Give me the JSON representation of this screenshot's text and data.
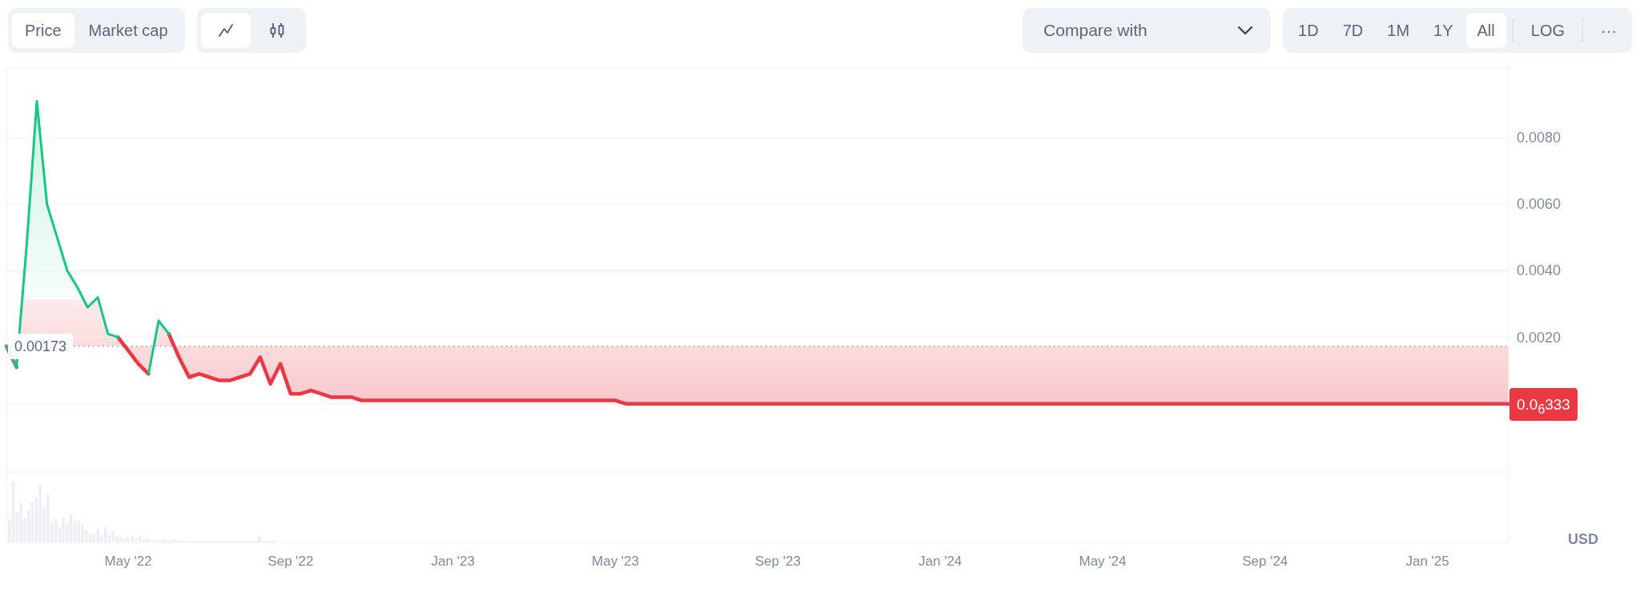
{
  "metric_tabs": [
    {
      "label": "Price",
      "selected": true
    },
    {
      "label": "Market cap",
      "selected": false
    }
  ],
  "chart_type_buttons": [
    {
      "kind": "line",
      "selected": true
    },
    {
      "kind": "candles",
      "selected": false
    }
  ],
  "compare_dropdown": {
    "label": "Compare with"
  },
  "range_buttons": [
    {
      "label": "1D",
      "selected": false
    },
    {
      "label": "7D",
      "selected": false
    },
    {
      "label": "1M",
      "selected": false
    },
    {
      "label": "1Y",
      "selected": false
    },
    {
      "label": "All",
      "selected": true
    }
  ],
  "log_button": {
    "label": "LOG",
    "selected": false
  },
  "more_button": {
    "label": "···"
  },
  "chart": {
    "baseline_label": "0.00173",
    "current_price_label": "0.0$_{6}$333",
    "chart_data": {
      "type": "line",
      "ylabel": "USD",
      "grid": true,
      "categories": [
        null,
        null,
        null,
        null,
        null,
        null,
        null,
        null,
        null,
        null,
        null,
        null,
        "May '22",
        null,
        null,
        null,
        null,
        null,
        null,
        null,
        null,
        null,
        null,
        null,
        null,
        null,
        null,
        null,
        "Sep '22",
        null,
        null,
        null,
        null,
        null,
        null,
        null,
        null,
        null,
        null,
        null,
        null,
        null,
        null,
        null,
        "Jan '23",
        null,
        null,
        null,
        null,
        null,
        null,
        null,
        null,
        null,
        null,
        null,
        null,
        null,
        null,
        null,
        "May '23",
        null,
        null,
        null,
        null,
        null,
        null,
        null,
        null,
        null,
        null,
        null,
        null,
        null,
        null,
        null,
        "Sep '23",
        null,
        null,
        null,
        null,
        null,
        null,
        null,
        null,
        null,
        null,
        null,
        null,
        null,
        null,
        null,
        "Jan '24",
        null,
        null,
        null,
        null,
        null,
        null,
        null,
        null,
        null,
        null,
        null,
        null,
        null,
        null,
        null,
        "May '24",
        null,
        null,
        null,
        null,
        null,
        null,
        null,
        null,
        null,
        null,
        null,
        null,
        null,
        null,
        null,
        "Sep '24",
        null,
        null,
        null,
        null,
        null,
        null,
        null,
        null,
        null,
        null,
        null,
        null,
        null,
        null,
        null,
        "Jan '25",
        null,
        null,
        null,
        null,
        null,
        null,
        null,
        null
      ],
      "series": [
        {
          "color": "#16c784",
          "values": [
            0.00173,
            0.0011,
            0.0048,
            0.0091,
            0.006,
            0.005,
            0.004,
            0.0035,
            0.0029,
            0.0032,
            0.0021,
            0.002,
            null,
            null,
            0.0009,
            0.0025,
            0.0021,
            null,
            null,
            null,
            null,
            null,
            null,
            null,
            null,
            null,
            null,
            null,
            null,
            null,
            null,
            null,
            null,
            null,
            null,
            null,
            null,
            null,
            null,
            null,
            null,
            null,
            null,
            null,
            null,
            null,
            null,
            null,
            null,
            null,
            null,
            null,
            null,
            null,
            null,
            null,
            null,
            null,
            null,
            null,
            null,
            null,
            null,
            null,
            null,
            null,
            null,
            null,
            null,
            null,
            null,
            null,
            null,
            null,
            null,
            null,
            null,
            null,
            null,
            null,
            null,
            null,
            null,
            null,
            null,
            null,
            null,
            null,
            null,
            null,
            null,
            null,
            null,
            null,
            null,
            null,
            null,
            null,
            null,
            null,
            null,
            null,
            null,
            null,
            null,
            null,
            null,
            null,
            null,
            null,
            null,
            null,
            null,
            null,
            null,
            null,
            null,
            null,
            null,
            null,
            null,
            null,
            null,
            null,
            null,
            null,
            null,
            null,
            null,
            null,
            null,
            null,
            null,
            null,
            null,
            null,
            null,
            null,
            null,
            null,
            null,
            null,
            null,
            null,
            null,
            null,
            null,
            null,
            null
          ]
        },
        {
          "color": "#ea3943",
          "values": [
            0.00173,
            0.0011,
            null,
            null,
            null,
            null,
            null,
            null,
            null,
            null,
            null,
            0.002,
            0.0016,
            0.0012,
            0.0009,
            null,
            0.0021,
            0.0014,
            0.0008,
            0.0009,
            0.0008,
            0.0007,
            0.0007,
            0.0008,
            0.0009,
            0.0014,
            0.0006,
            0.0012,
            0.0003,
            0.0003,
            0.0004,
            0.0003,
            0.0002,
            0.0002,
            0.0002,
            0.0001,
            0.0001,
            0.0001,
            0.0001,
            0.0001,
            0.0001,
            0.0001,
            0.0001,
            0.0001,
            0.0001,
            0.0001,
            0.0001,
            0.0001,
            0.0001,
            0.0001,
            0.0001,
            0.0001,
            0.0001,
            0.0001,
            0.0001,
            0.0001,
            0.0001,
            0.0001,
            0.0001,
            0.0001,
            0.0001,
            0,
            0,
            0,
            0,
            0,
            0,
            0,
            0,
            0,
            0,
            0,
            0,
            0,
            0,
            0,
            0,
            0,
            0,
            0,
            0,
            0,
            0,
            0,
            0,
            0,
            0,
            0,
            0,
            0,
            0,
            0,
            0,
            0,
            0,
            0,
            0,
            0,
            0,
            0,
            0,
            0,
            0,
            0,
            0,
            0,
            0,
            0,
            0,
            0,
            0,
            0,
            0,
            0,
            0,
            0,
            0,
            0,
            0,
            0,
            0,
            0,
            0,
            0,
            0,
            0,
            0,
            0,
            0,
            0,
            0,
            0,
            0,
            0,
            0,
            0,
            0,
            0,
            0,
            0,
            0,
            0,
            0,
            0,
            0,
            0,
            0,
            0,
            0
          ]
        }
      ],
      "ylim": [
        -0.00417,
        0.0101
      ],
      "yticks": [
        {
          "value": 0.002,
          "label": "0.0020"
        },
        {
          "value": 0.004,
          "label": "0.0040"
        },
        {
          "value": 0.006,
          "label": "0.0060"
        },
        {
          "value": 0.008,
          "label": "0.0080"
        }
      ]
    }
  }
}
